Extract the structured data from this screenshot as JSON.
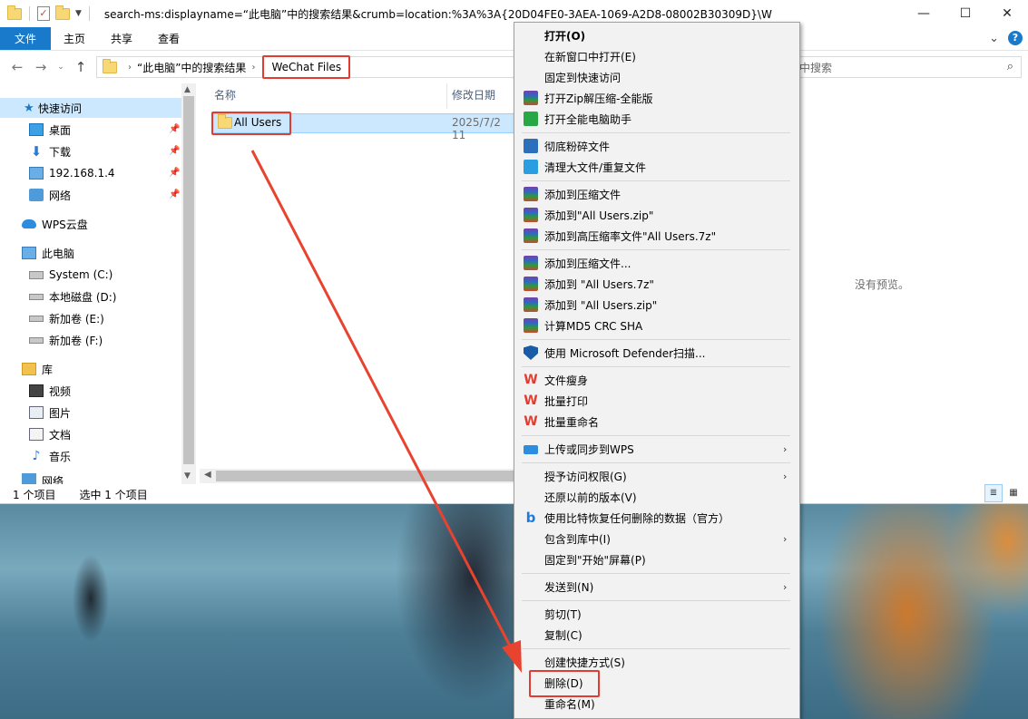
{
  "window": {
    "title": "search-ms:displayname=“此电脑”中的搜索结果&crumb=location:%3A%3A{20D04FE0-3AEA-1069-A2D8-08002B30309D}\\W",
    "minimize": "—",
    "maximize": "☐",
    "close": "✕"
  },
  "ribbon": {
    "tabs": [
      "文件",
      "主页",
      "共享",
      "查看"
    ],
    "collapse": "⌄",
    "help": "?"
  },
  "nav": {
    "back": "←",
    "forward": "→",
    "recent": "⌄",
    "up": "↑",
    "crumbs": [
      "“此电脑”中的搜索结果",
      "WeChat Files"
    ],
    "crumb_sep": "›",
    "search_placeholder": "中搜索",
    "search_icon": "⌕"
  },
  "sidebar": {
    "quick_access": "快速访问",
    "items": [
      {
        "label": "桌面",
        "pinned": true
      },
      {
        "label": "下载",
        "pinned": true
      },
      {
        "label": "192.168.1.4",
        "pinned": true
      },
      {
        "label": "网络",
        "pinned": true
      }
    ],
    "wps_cloud": "WPS云盘",
    "this_pc": "此电脑",
    "drives": [
      "System (C:)",
      "本地磁盘 (D:)",
      "新加卷 (E:)",
      "新加卷 (F:)"
    ],
    "library": "库",
    "library_items": [
      "视频",
      "图片",
      "文档",
      "音乐"
    ],
    "cut_item": "网络",
    "pin_glyph": "📌"
  },
  "files": {
    "col_name": "名称",
    "col_date": "修改日期",
    "rows": [
      {
        "name": "All Users",
        "date": "2025/7/2 11"
      }
    ]
  },
  "preview": {
    "empty_text": "没有预览。"
  },
  "status": {
    "count": "1 个项目",
    "selected": "选中 1 个项目"
  },
  "context_menu": {
    "items": [
      {
        "label": "打开(O)",
        "bold": true
      },
      {
        "label": "在新窗口中打开(E)"
      },
      {
        "label": "固定到快速访问"
      },
      {
        "label": "打开Zip解压缩-全能版",
        "icon": "zip-icon"
      },
      {
        "label": "打开全能电脑助手",
        "icon": "assistant-icon"
      },
      {
        "label": "彻底粉碎文件",
        "icon": "shred-icon"
      },
      {
        "label": "清理大文件/重复文件",
        "icon": "clean-icon"
      },
      {
        "label": "添加到压缩文件",
        "icon": "zip-icon"
      },
      {
        "label": "添加到\"All Users.zip\"",
        "icon": "zip-icon"
      },
      {
        "label": "添加到高压缩率文件\"All Users.7z\"",
        "icon": "zip-icon"
      },
      {
        "label": "添加到压缩文件...",
        "icon": "zip-icon"
      },
      {
        "label": "添加到 \"All Users.7z\"",
        "icon": "zip-icon"
      },
      {
        "label": "添加到 \"All Users.zip\"",
        "icon": "zip-icon"
      },
      {
        "label": "计算MD5 CRC SHA",
        "icon": "zip-icon"
      },
      {
        "label": "使用 Microsoft Defender扫描...",
        "icon": "defender-icon"
      },
      {
        "label": "文件瘦身",
        "icon": "wps-icon"
      },
      {
        "label": "批量打印",
        "icon": "wps-icon"
      },
      {
        "label": "批量重命名",
        "icon": "wps-icon"
      },
      {
        "label": "上传或同步到WPS",
        "icon": "cloud-icon",
        "submenu": true
      },
      {
        "label": "授予访问权限(G)",
        "submenu": true
      },
      {
        "label": "还原以前的版本(V)"
      },
      {
        "label": "使用比特恢复任何删除的数据（官方）",
        "icon": "bitrecover-icon"
      },
      {
        "label": "包含到库中(I)",
        "submenu": true
      },
      {
        "label": "固定到\"开始\"屏幕(P)"
      },
      {
        "label": "发送到(N)",
        "submenu": true
      },
      {
        "label": "剪切(T)"
      },
      {
        "label": "复制(C)"
      },
      {
        "label": "创建快捷方式(S)"
      },
      {
        "label": "删除(D)"
      },
      {
        "label": "重命名(M)"
      }
    ],
    "submenu_glyph": "›",
    "wps_glyph": "W",
    "b_glyph": "b"
  },
  "colors": {
    "accent": "#1979ca",
    "highlight_red": "#e03c31",
    "selection": "#cce8ff"
  }
}
